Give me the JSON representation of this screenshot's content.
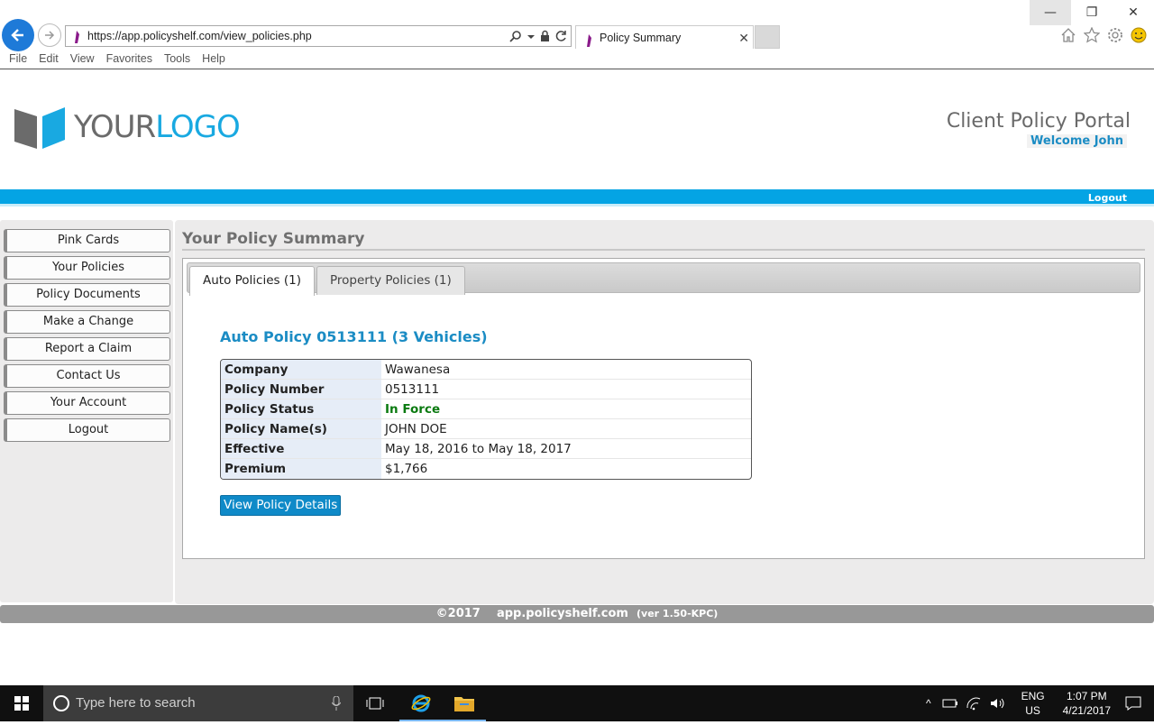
{
  "browser": {
    "url": "https://app.policyshelf.com/view_policies.php",
    "tab_title": "Policy Summary",
    "menu": [
      "File",
      "Edit",
      "View",
      "Favorites",
      "Tools",
      "Help"
    ]
  },
  "header": {
    "logo_part1": "YOUR",
    "logo_part2": "LOGO",
    "portal_title": "Client Policy Portal",
    "welcome": "Welcome John",
    "logout": "Logout"
  },
  "sidebar": {
    "items": [
      "Pink Cards",
      "Your Policies",
      "Policy Documents",
      "Make a Change",
      "Report a Claim",
      "Contact Us",
      "Your Account",
      "Logout"
    ]
  },
  "main": {
    "title": "Your Policy Summary",
    "tabs": [
      "Auto Policies (1)",
      "Property Policies (1)"
    ],
    "policy_heading": "Auto Policy 0513111 (3 Vehicles)",
    "details": [
      {
        "label": "Company",
        "value": "Wawanesa"
      },
      {
        "label": "Policy Number",
        "value": "0513111"
      },
      {
        "label": "Policy Status",
        "value": "In Force"
      },
      {
        "label": "Policy Name(s)",
        "value": "JOHN DOE"
      },
      {
        "label": "Effective",
        "value": "May 18, 2016 to May 18, 2017"
      },
      {
        "label": "Premium",
        "value": "$1,766"
      }
    ],
    "view_button": "View Policy Details"
  },
  "footer": {
    "copyright": "©2017",
    "site": "app.policyshelf.com",
    "version": "(ver 1.50-KPC)"
  },
  "taskbar": {
    "search_placeholder": "Type here to search",
    "lang_line1": "ENG",
    "lang_line2": "US",
    "time": "1:07 PM",
    "date": "4/21/2017"
  },
  "colors": {
    "brand_blue": "#04a4e4",
    "link_blue": "#1b8cc4",
    "status_green": "#0a7a10"
  }
}
